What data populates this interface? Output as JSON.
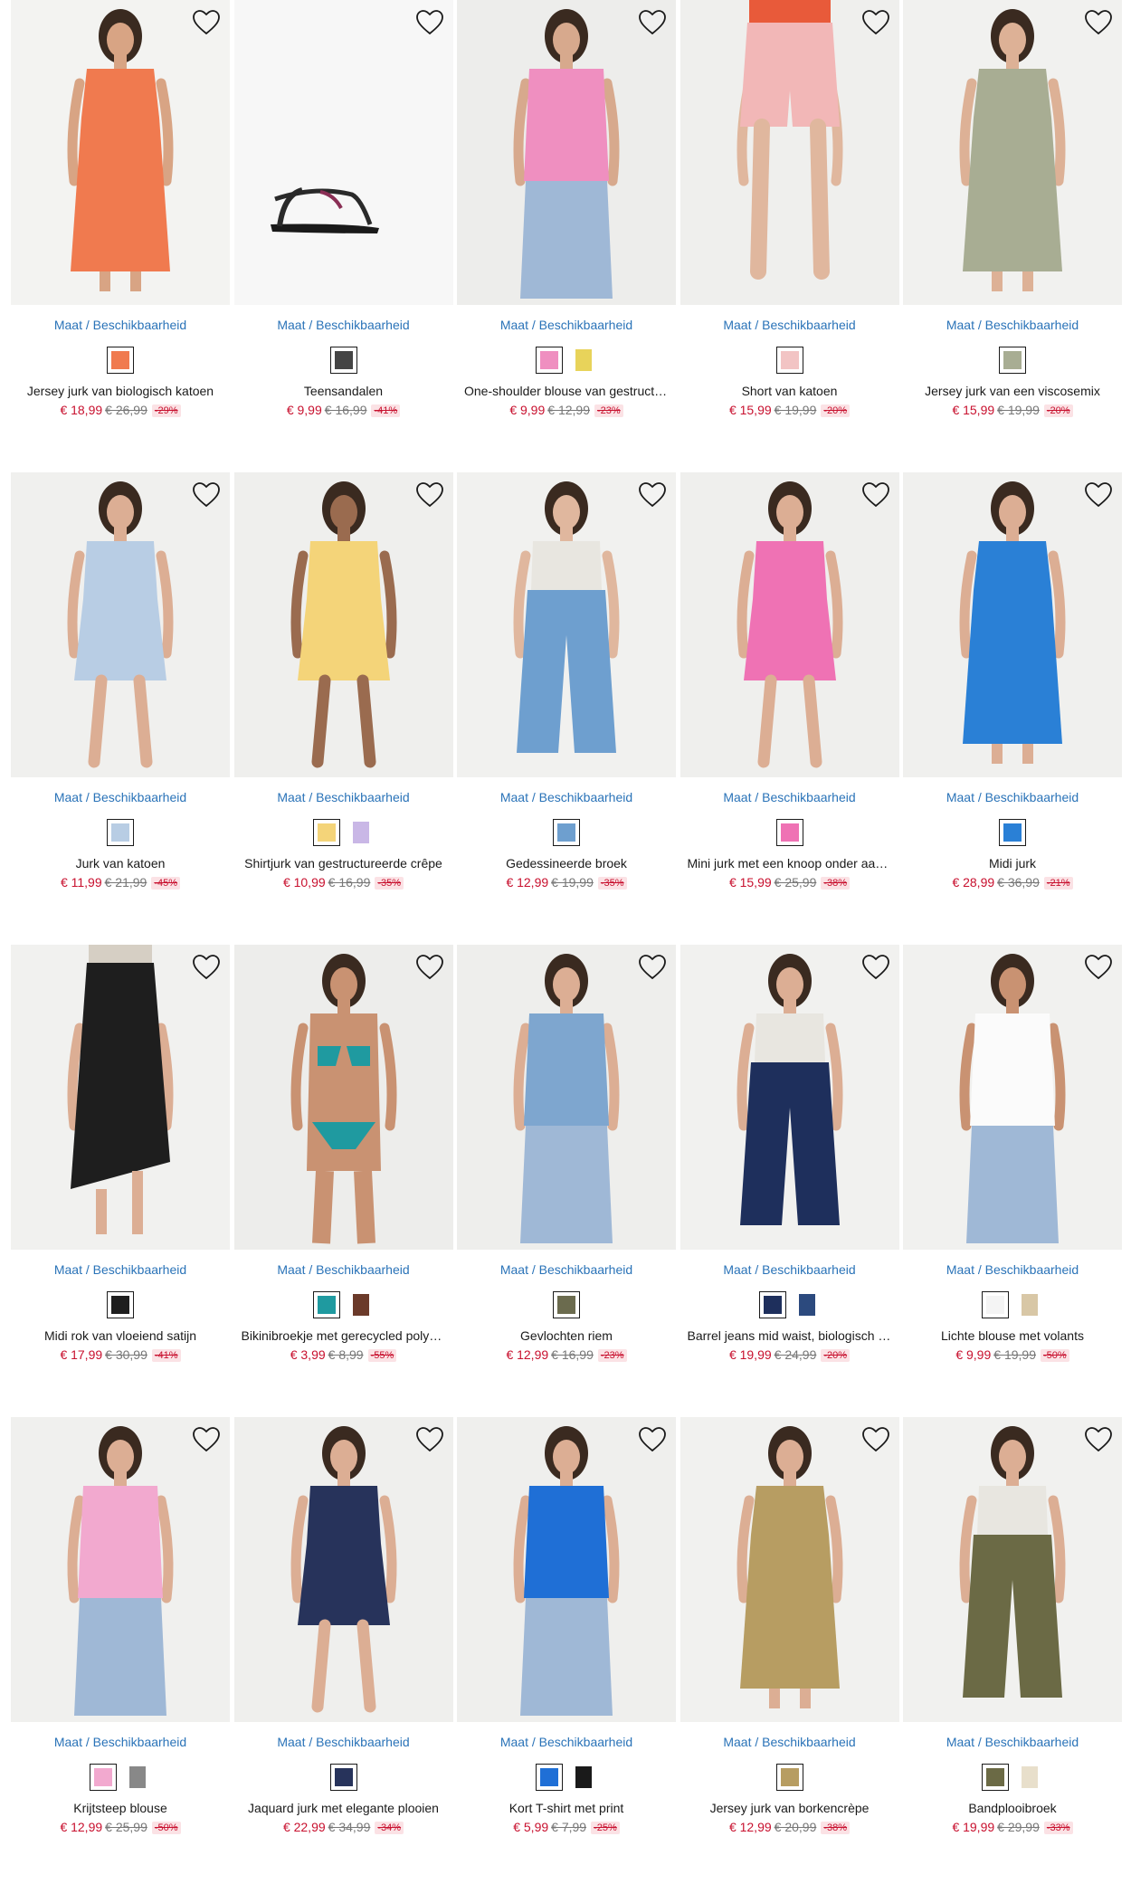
{
  "sizes_label": "Maat / Beschikbaarheid",
  "colors": {
    "link": "#2a73b8",
    "sale_price": "#c8102e",
    "old_price": "#777777",
    "discount_bg": "#fbe2e5"
  },
  "products": [
    {
      "name": "Jersey jurk van biologisch katoen",
      "price": "€ 18,99",
      "old_price": "€ 26,99",
      "discount": "-29%",
      "bg": "#f3f3f1",
      "garment": "#f07a4f",
      "skin": "#d8a484",
      "kind": "dress",
      "swatches": [
        "#f07a4f"
      ]
    },
    {
      "name": "Teensandalen",
      "price": "€ 9,99",
      "old_price": "€ 16,99",
      "discount": "-41%",
      "bg": "#f7f7f7",
      "garment": "#2a2a2a",
      "skin": "#f7f7f7",
      "kind": "sandal",
      "swatches": [
        "#444444"
      ]
    },
    {
      "name": "One-shoulder blouse van gestructu...",
      "price": "€ 9,99",
      "old_price": "€ 12,99",
      "discount": "-23%",
      "bg": "#ededeb",
      "garment": "#ef8fc0",
      "skin": "#d7a98d",
      "kind": "top",
      "swatches": [
        "#ef8fc0",
        "#e8d35a"
      ]
    },
    {
      "name": "Short van katoen",
      "price": "€ 15,99",
      "old_price": "€ 19,99",
      "discount": "-20%",
      "bg": "#efefed",
      "garment": "#f2b7b7",
      "skin": "#e0b79e",
      "kind": "shorts",
      "swatches": [
        "#f2c4c4"
      ]
    },
    {
      "name": "Jersey jurk van een viscosemix",
      "price": "€ 15,99",
      "old_price": "€ 19,99",
      "discount": "-20%",
      "bg": "#f1f1ef",
      "garment": "#a8ad93",
      "skin": "#ddb196",
      "kind": "dress",
      "swatches": [
        "#a8ad93"
      ]
    },
    {
      "name": "Jurk van katoen",
      "price": "€ 11,99",
      "old_price": "€ 21,99",
      "discount": "-45%",
      "bg": "#f0f0ee",
      "garment": "#b8cde4",
      "skin": "#dcae94",
      "kind": "shortdress",
      "swatches": [
        "#b8cde4"
      ]
    },
    {
      "name": "Shirtjurk van gestructureerde crêpe",
      "price": "€ 10,99",
      "old_price": "€ 16,99",
      "discount": "-35%",
      "bg": "#efefed",
      "garment": "#f4d479",
      "skin": "#9a6b4f",
      "kind": "shortdress",
      "swatches": [
        "#f4d479",
        "#c9b7e6"
      ]
    },
    {
      "name": "Gedessineerde broek",
      "price": "€ 12,99",
      "old_price": "€ 19,99",
      "discount": "-35%",
      "bg": "#f1f1ef",
      "garment": "#6e9fcf",
      "skin": "#e0b79e",
      "kind": "pants",
      "swatches": [
        "#6e9fcf"
      ]
    },
    {
      "name": "Mini jurk met een knoop onder aan ...",
      "price": "€ 15,99",
      "old_price": "€ 25,99",
      "discount": "-38%",
      "bg": "#efefed",
      "garment": "#ef72b4",
      "skin": "#dcae94",
      "kind": "shortdress",
      "swatches": [
        "#ef72b4"
      ]
    },
    {
      "name": "Midi jurk",
      "price": "€ 28,99",
      "old_price": "€ 36,99",
      "discount": "-21%",
      "bg": "#f0f0ee",
      "garment": "#2a80d6",
      "skin": "#dcae94",
      "kind": "dress",
      "swatches": [
        "#2a80d6"
      ]
    },
    {
      "name": "Midi rok van vloeiend satijn",
      "price": "€ 17,99",
      "old_price": "€ 30,99",
      "discount": "-41%",
      "bg": "#f1f1ef",
      "garment": "#1e1e1e",
      "skin": "#dcae94",
      "kind": "skirt",
      "swatches": [
        "#1e1e1e"
      ]
    },
    {
      "name": "Bikinibroekje met gerecycled polya...",
      "price": "€ 3,99",
      "old_price": "€ 8,99",
      "discount": "-55%",
      "bg": "#ededeb",
      "garment": "#1f9aa0",
      "skin": "#c99272",
      "kind": "bikini",
      "swatches": [
        "#1f9aa0",
        "#6b3a2a"
      ]
    },
    {
      "name": "Gevlochten riem",
      "price": "€ 12,99",
      "old_price": "€ 16,99",
      "discount": "-23%",
      "bg": "#eeeeec",
      "garment": "#7ea6cf",
      "skin": "#dcae94",
      "kind": "top",
      "swatches": [
        "#6b6b4e"
      ]
    },
    {
      "name": "Barrel jeans mid waist, biologisch k...",
      "price": "€ 19,99",
      "old_price": "€ 24,99",
      "discount": "-20%",
      "bg": "#f1f1ef",
      "garment": "#1e2f5c",
      "skin": "#dcae94",
      "kind": "pants",
      "swatches": [
        "#1e2f5c",
        "#2c4a7e"
      ]
    },
    {
      "name": "Lichte blouse met volants",
      "price": "€ 9,99",
      "old_price": "€ 19,99",
      "discount": "-50%",
      "bg": "#f1f1ef",
      "garment": "#fbfbfb",
      "skin": "#c99272",
      "kind": "top",
      "swatches": [
        "#f4f4f4",
        "#d8c7a6"
      ]
    },
    {
      "name": "Krijtsteep blouse",
      "price": "€ 12,99",
      "old_price": "€ 25,99",
      "discount": "-50%",
      "bg": "#f0f0ee",
      "garment": "#f2a9cf",
      "skin": "#dcae94",
      "kind": "top",
      "swatches": [
        "#f2a9cf",
        "#888888"
      ]
    },
    {
      "name": "Jaquard jurk met elegante plooien",
      "price": "€ 22,99",
      "old_price": "€ 34,99",
      "discount": "-34%",
      "bg": "#efefed",
      "garment": "#27335b",
      "skin": "#dcae94",
      "kind": "shortdress",
      "swatches": [
        "#27335b"
      ]
    },
    {
      "name": "Kort T-shirt met print",
      "price": "€ 5,99",
      "old_price": "€ 7,99",
      "discount": "-25%",
      "bg": "#efefed",
      "garment": "#1f6fd6",
      "skin": "#dcae94",
      "kind": "top",
      "swatches": [
        "#1f6fd6",
        "#1a1a1a"
      ]
    },
    {
      "name": "Jersey jurk van borkencrèpe",
      "price": "€ 12,99",
      "old_price": "€ 20,99",
      "discount": "-38%",
      "bg": "#f1f1ef",
      "garment": "#b79d62",
      "skin": "#dcae94",
      "kind": "dress",
      "swatches": [
        "#b79d62"
      ]
    },
    {
      "name": "Bandplooibroek",
      "price": "€ 19,99",
      "old_price": "€ 29,99",
      "discount": "-33%",
      "bg": "#f1f1ef",
      "garment": "#6b6a45",
      "skin": "#dcae94",
      "kind": "pants",
      "swatches": [
        "#6b6a45",
        "#e8dfcb"
      ]
    }
  ]
}
